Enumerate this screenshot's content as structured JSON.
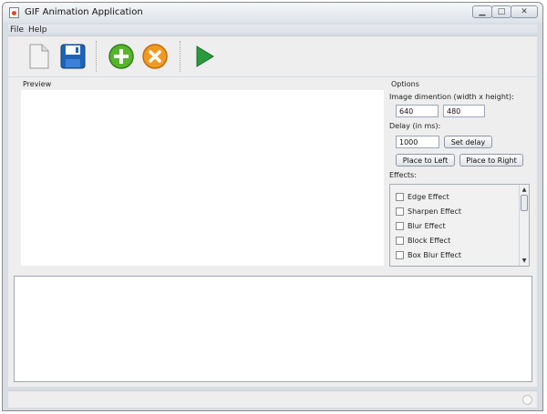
{
  "window": {
    "title": "GIF Animation Application",
    "controls": [
      "minimize",
      "maximize",
      "close"
    ]
  },
  "menu": {
    "items": [
      "File",
      "Help"
    ]
  },
  "toolbar": {
    "icons": [
      "new-document-icon",
      "save-icon",
      "add-icon",
      "remove-icon",
      "play-icon"
    ]
  },
  "preview": {
    "label": "Preview"
  },
  "options": {
    "title": "Options",
    "dimension_label": "Image dimention (width x height):",
    "width_value": "640",
    "height_value": "480",
    "delay_label": "Delay (in ms):",
    "delay_value": "1000",
    "set_delay_button": "Set delay",
    "place_left_button": "Place to Left",
    "place_right_button": "Place to Right",
    "effects_label": "Effects:",
    "effects": [
      "Edge Effect",
      "Sharpen Effect",
      "Blur Effect",
      "Block Effect",
      "Box Blur Effect"
    ]
  }
}
